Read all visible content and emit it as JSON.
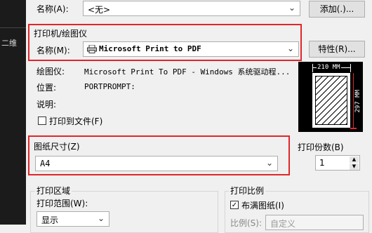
{
  "left_panel": {
    "text": "二维"
  },
  "page_setup": {
    "name_label": "名称(A):",
    "name_value": "<无>",
    "add_button": "添加(.)..."
  },
  "printer": {
    "group_label": "打印机/绘图仪",
    "name_label": "名称(M):",
    "name_value": "Microsoft Print to PDF",
    "properties_button": "特性(R)...",
    "plotter_label": "绘图仪:",
    "plotter_value": "Microsoft Print To PDF - Windows 系统驱动程...",
    "location_label": "位置:",
    "location_value": "PORTPROMPT:",
    "description_label": "说明:",
    "print_to_file_label": "打印到文件(F)"
  },
  "preview": {
    "width_text": "210 MM",
    "height_text": "297 MM"
  },
  "paper_size": {
    "group_label": "图纸尺寸(Z)",
    "value": "A4"
  },
  "copies": {
    "label": "打印份数(B)",
    "value": "1"
  },
  "plot_area": {
    "group_label": "打印区域",
    "range_label": "打印范围(W):",
    "range_value": "显示"
  },
  "plot_scale": {
    "group_label": "打印比例",
    "fit_label": "布满图纸(I)",
    "fit_checked": "✓",
    "scale_label": "比例(S):",
    "scale_value": "自定义"
  },
  "colors": {
    "highlight": "#e0262b",
    "preview_bg": "#000000",
    "dim_line": "#e0262b"
  }
}
